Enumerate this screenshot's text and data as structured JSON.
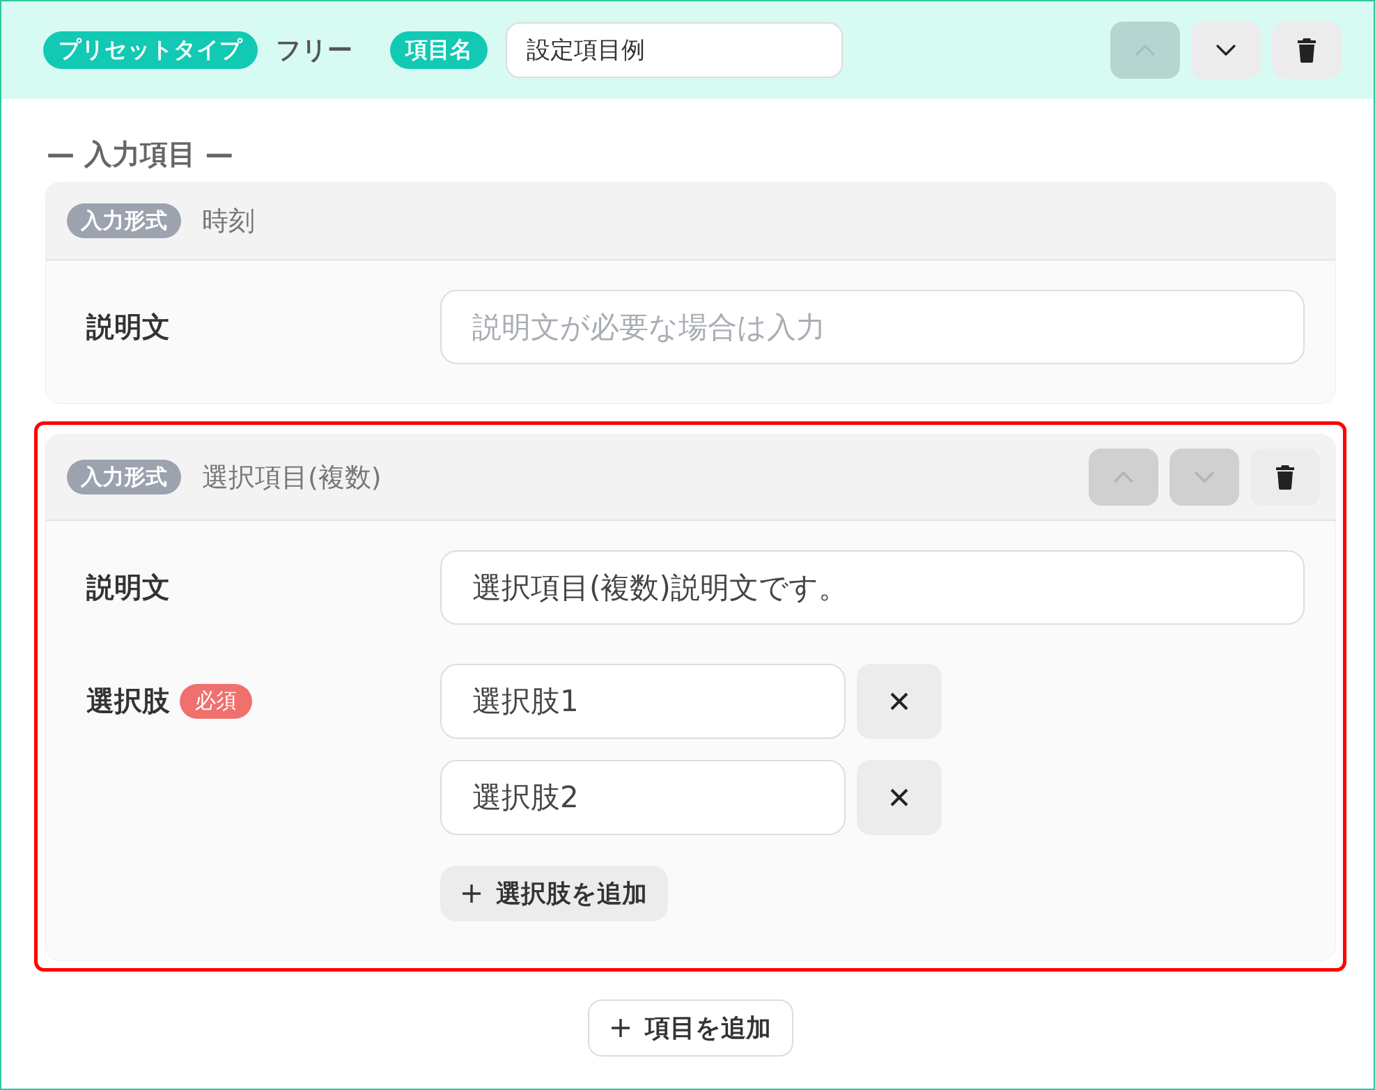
{
  "header": {
    "preset_label": "プリセットタイプ",
    "preset_value": "フリー",
    "name_label": "項目名",
    "name_value": "設定項目例",
    "buttons": [
      {
        "kind": "up",
        "disabled": true
      },
      {
        "kind": "down",
        "disabled": false
      },
      {
        "kind": "trash",
        "disabled": false
      }
    ]
  },
  "section_title": "— 入力項目 —",
  "items": [
    {
      "type_label": "入力形式",
      "type_value": "時刻",
      "highlighted": false,
      "fields": [
        {
          "kind": "text",
          "label": "説明文",
          "placeholder": "説明文が必要な場合は入力"
        }
      ]
    },
    {
      "type_label": "入力形式",
      "type_value": "選択項目(複数)",
      "highlighted": true,
      "buttons": [
        {
          "kind": "up",
          "disabled": true
        },
        {
          "kind": "down",
          "disabled": true
        },
        {
          "kind": "trash",
          "disabled": false
        }
      ],
      "fields": [
        {
          "kind": "text",
          "label": "説明文",
          "value": "選択項目(複数)説明文です。"
        },
        {
          "kind": "options",
          "label": "選択肢",
          "required_badge": "必須",
          "options": [
            "選択肢1",
            "選択肢2"
          ],
          "add_label": "選択肢を追加"
        }
      ]
    }
  ],
  "add_item_label": "項目を追加"
}
